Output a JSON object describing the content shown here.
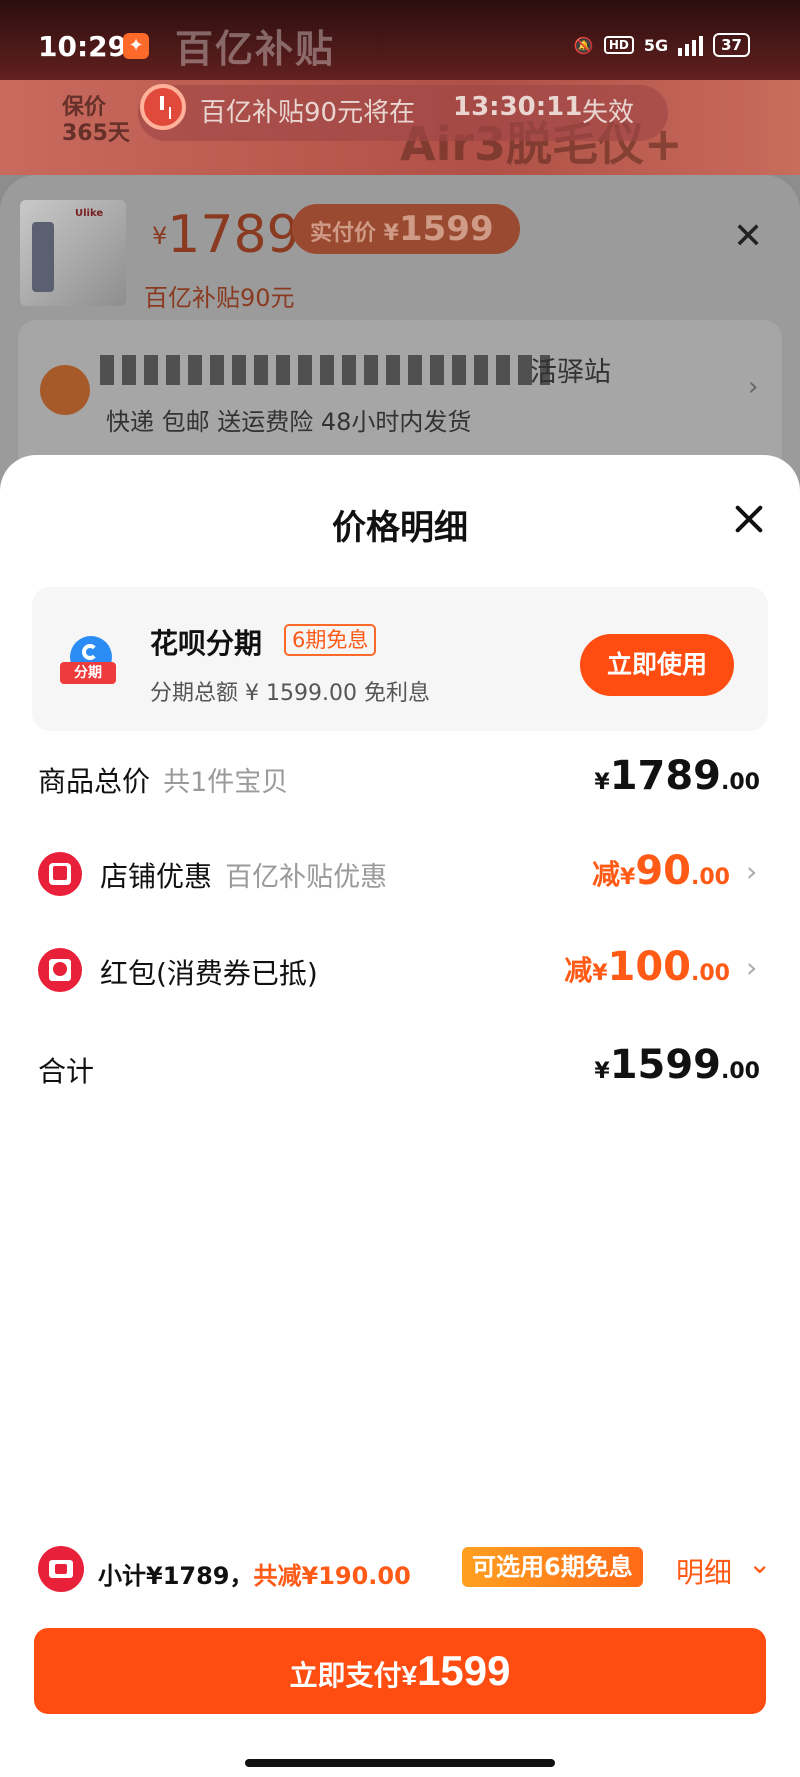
{
  "status_bar": {
    "time": "10:29",
    "network": "5G",
    "hd": "HD",
    "battery": "37"
  },
  "background": {
    "brand": "百亿补贴",
    "guarantee": [
      "保价",
      "365天"
    ],
    "promo": "Air3脱毛仪+",
    "timer": {
      "prefix": "百亿补贴90元将在",
      "time": "13:30:11",
      "suffix": "失效"
    }
  },
  "product": {
    "thumb_brand": "Ulike",
    "price_symbol": "¥",
    "price": "1789",
    "actual_label": "实付价 ¥",
    "actual_price": "1599",
    "subsidy": "百亿补贴90元"
  },
  "shop": {
    "name": "活驿站",
    "delivery": "快递 包邮 送运费险 48小时内发货"
  },
  "sheet": {
    "title": "价格明细",
    "huabei": {
      "title": "花呗分期",
      "badge": "6期免息",
      "subtitle": "分期总额 ¥ 1599.00 免利息",
      "logo_tag": "分期",
      "button": "立即使用"
    },
    "rows": {
      "total": {
        "label": "商品总价",
        "note": "共1件宝贝",
        "currency": "¥",
        "int": "1789",
        "dec": ".00"
      },
      "shop_discount": {
        "label": "店铺优惠",
        "note": "百亿补贴优惠",
        "prefix": "减",
        "currency": "¥",
        "int": "90",
        "dec": ".00"
      },
      "red_packet": {
        "label": "红包(消费券已抵)",
        "prefix": "减",
        "currency": "¥",
        "int": "100",
        "dec": ".00"
      },
      "sum": {
        "label": "合计",
        "currency": "¥",
        "int": "1599",
        "dec": ".00"
      }
    }
  },
  "footer": {
    "subtotal": "小计¥1789，",
    "reduced": "共减¥190.00",
    "installment_badge": "可选用6期免息",
    "detail": "明细",
    "pay_label": "立即支付¥",
    "pay_amount": "1599"
  },
  "colors": {
    "accent": "#ff4d12",
    "discount": "#ff5a16",
    "red_icon": "#e8203a",
    "huabei_blue": "#2b8cf5"
  }
}
